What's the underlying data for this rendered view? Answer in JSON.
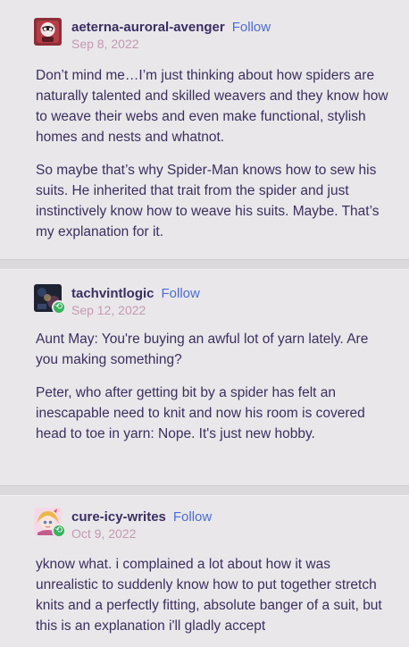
{
  "posts": [
    {
      "username": "aeterna-auroral-avenger",
      "follow_label": "Follow",
      "date": "Sep 8, 2022",
      "avatar_icon": "red-mask-avatar-icon",
      "reblogged": false,
      "paragraphs": [
        "Don’t mind me…I’m just thinking about how spiders are naturally talented and skilled weavers and they know how to weave their webs and even make functional, stylish homes and nests and whatnot.",
        "So maybe that’s why Spider-Man knows how to sew his suits. He inherited that trait from the spider and just instinctively know how to weave his suits. Maybe. That’s my explanation for it."
      ]
    },
    {
      "username": "tachvintlogic",
      "follow_label": "Follow",
      "date": "Sep 12, 2022",
      "avatar_icon": "dark-figure-avatar-icon",
      "reblogged": true,
      "paragraphs": [
        "Aunt May: You're buying an awful lot of yarn lately. Are you making something?",
        "Peter, who after getting bit by a spider has felt an inescapable need to knit and now his room is covered head to toe in yarn: Nope. It's just new hobby."
      ]
    },
    {
      "username": "cure-icy-writes",
      "follow_label": "Follow",
      "date": "Oct 9, 2022",
      "avatar_icon": "anime-character-avatar-icon",
      "reblogged": true,
      "paragraphs": [
        "yknow what. i complained a lot about how it was unrealistic to suddenly know how to put together stretch knits and a perfectly fitting, absolute banger of a suit, but this is an explanation i'll gladly accept"
      ]
    }
  ],
  "colors": {
    "background": "#e9e7ea",
    "username": "#3b2e63",
    "follow": "#4c6cd8",
    "date": "#c39ab1",
    "body_text": "#3c2f5e",
    "reblog_badge": "#35b35a"
  }
}
